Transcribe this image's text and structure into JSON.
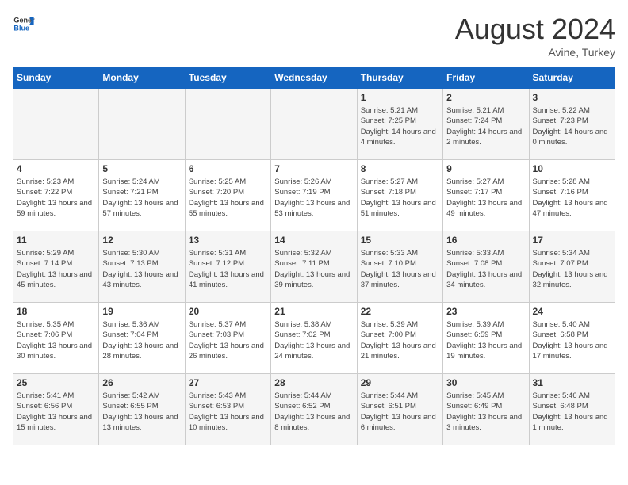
{
  "header": {
    "logo_general": "General",
    "logo_blue": "Blue",
    "title": "August 2024",
    "location": "Avine, Turkey"
  },
  "days_of_week": [
    "Sunday",
    "Monday",
    "Tuesday",
    "Wednesday",
    "Thursday",
    "Friday",
    "Saturday"
  ],
  "weeks": [
    [
      {
        "day": "",
        "sunrise": "",
        "sunset": "",
        "daylight": "",
        "empty": true
      },
      {
        "day": "",
        "sunrise": "",
        "sunset": "",
        "daylight": "",
        "empty": true
      },
      {
        "day": "",
        "sunrise": "",
        "sunset": "",
        "daylight": "",
        "empty": true
      },
      {
        "day": "",
        "sunrise": "",
        "sunset": "",
        "daylight": "",
        "empty": true
      },
      {
        "day": "1",
        "sunrise": "Sunrise: 5:21 AM",
        "sunset": "Sunset: 7:25 PM",
        "daylight": "Daylight: 14 hours and 4 minutes.",
        "empty": false
      },
      {
        "day": "2",
        "sunrise": "Sunrise: 5:21 AM",
        "sunset": "Sunset: 7:24 PM",
        "daylight": "Daylight: 14 hours and 2 minutes.",
        "empty": false
      },
      {
        "day": "3",
        "sunrise": "Sunrise: 5:22 AM",
        "sunset": "Sunset: 7:23 PM",
        "daylight": "Daylight: 14 hours and 0 minutes.",
        "empty": false
      }
    ],
    [
      {
        "day": "4",
        "sunrise": "Sunrise: 5:23 AM",
        "sunset": "Sunset: 7:22 PM",
        "daylight": "Daylight: 13 hours and 59 minutes.",
        "empty": false
      },
      {
        "day": "5",
        "sunrise": "Sunrise: 5:24 AM",
        "sunset": "Sunset: 7:21 PM",
        "daylight": "Daylight: 13 hours and 57 minutes.",
        "empty": false
      },
      {
        "day": "6",
        "sunrise": "Sunrise: 5:25 AM",
        "sunset": "Sunset: 7:20 PM",
        "daylight": "Daylight: 13 hours and 55 minutes.",
        "empty": false
      },
      {
        "day": "7",
        "sunrise": "Sunrise: 5:26 AM",
        "sunset": "Sunset: 7:19 PM",
        "daylight": "Daylight: 13 hours and 53 minutes.",
        "empty": false
      },
      {
        "day": "8",
        "sunrise": "Sunrise: 5:27 AM",
        "sunset": "Sunset: 7:18 PM",
        "daylight": "Daylight: 13 hours and 51 minutes.",
        "empty": false
      },
      {
        "day": "9",
        "sunrise": "Sunrise: 5:27 AM",
        "sunset": "Sunset: 7:17 PM",
        "daylight": "Daylight: 13 hours and 49 minutes.",
        "empty": false
      },
      {
        "day": "10",
        "sunrise": "Sunrise: 5:28 AM",
        "sunset": "Sunset: 7:16 PM",
        "daylight": "Daylight: 13 hours and 47 minutes.",
        "empty": false
      }
    ],
    [
      {
        "day": "11",
        "sunrise": "Sunrise: 5:29 AM",
        "sunset": "Sunset: 7:14 PM",
        "daylight": "Daylight: 13 hours and 45 minutes.",
        "empty": false
      },
      {
        "day": "12",
        "sunrise": "Sunrise: 5:30 AM",
        "sunset": "Sunset: 7:13 PM",
        "daylight": "Daylight: 13 hours and 43 minutes.",
        "empty": false
      },
      {
        "day": "13",
        "sunrise": "Sunrise: 5:31 AM",
        "sunset": "Sunset: 7:12 PM",
        "daylight": "Daylight: 13 hours and 41 minutes.",
        "empty": false
      },
      {
        "day": "14",
        "sunrise": "Sunrise: 5:32 AM",
        "sunset": "Sunset: 7:11 PM",
        "daylight": "Daylight: 13 hours and 39 minutes.",
        "empty": false
      },
      {
        "day": "15",
        "sunrise": "Sunrise: 5:33 AM",
        "sunset": "Sunset: 7:10 PM",
        "daylight": "Daylight: 13 hours and 37 minutes.",
        "empty": false
      },
      {
        "day": "16",
        "sunrise": "Sunrise: 5:33 AM",
        "sunset": "Sunset: 7:08 PM",
        "daylight": "Daylight: 13 hours and 34 minutes.",
        "empty": false
      },
      {
        "day": "17",
        "sunrise": "Sunrise: 5:34 AM",
        "sunset": "Sunset: 7:07 PM",
        "daylight": "Daylight: 13 hours and 32 minutes.",
        "empty": false
      }
    ],
    [
      {
        "day": "18",
        "sunrise": "Sunrise: 5:35 AM",
        "sunset": "Sunset: 7:06 PM",
        "daylight": "Daylight: 13 hours and 30 minutes.",
        "empty": false
      },
      {
        "day": "19",
        "sunrise": "Sunrise: 5:36 AM",
        "sunset": "Sunset: 7:04 PM",
        "daylight": "Daylight: 13 hours and 28 minutes.",
        "empty": false
      },
      {
        "day": "20",
        "sunrise": "Sunrise: 5:37 AM",
        "sunset": "Sunset: 7:03 PM",
        "daylight": "Daylight: 13 hours and 26 minutes.",
        "empty": false
      },
      {
        "day": "21",
        "sunrise": "Sunrise: 5:38 AM",
        "sunset": "Sunset: 7:02 PM",
        "daylight": "Daylight: 13 hours and 24 minutes.",
        "empty": false
      },
      {
        "day": "22",
        "sunrise": "Sunrise: 5:39 AM",
        "sunset": "Sunset: 7:00 PM",
        "daylight": "Daylight: 13 hours and 21 minutes.",
        "empty": false
      },
      {
        "day": "23",
        "sunrise": "Sunrise: 5:39 AM",
        "sunset": "Sunset: 6:59 PM",
        "daylight": "Daylight: 13 hours and 19 minutes.",
        "empty": false
      },
      {
        "day": "24",
        "sunrise": "Sunrise: 5:40 AM",
        "sunset": "Sunset: 6:58 PM",
        "daylight": "Daylight: 13 hours and 17 minutes.",
        "empty": false
      }
    ],
    [
      {
        "day": "25",
        "sunrise": "Sunrise: 5:41 AM",
        "sunset": "Sunset: 6:56 PM",
        "daylight": "Daylight: 13 hours and 15 minutes.",
        "empty": false
      },
      {
        "day": "26",
        "sunrise": "Sunrise: 5:42 AM",
        "sunset": "Sunset: 6:55 PM",
        "daylight": "Daylight: 13 hours and 13 minutes.",
        "empty": false
      },
      {
        "day": "27",
        "sunrise": "Sunrise: 5:43 AM",
        "sunset": "Sunset: 6:53 PM",
        "daylight": "Daylight: 13 hours and 10 minutes.",
        "empty": false
      },
      {
        "day": "28",
        "sunrise": "Sunrise: 5:44 AM",
        "sunset": "Sunset: 6:52 PM",
        "daylight": "Daylight: 13 hours and 8 minutes.",
        "empty": false
      },
      {
        "day": "29",
        "sunrise": "Sunrise: 5:44 AM",
        "sunset": "Sunset: 6:51 PM",
        "daylight": "Daylight: 13 hours and 6 minutes.",
        "empty": false
      },
      {
        "day": "30",
        "sunrise": "Sunrise: 5:45 AM",
        "sunset": "Sunset: 6:49 PM",
        "daylight": "Daylight: 13 hours and 3 minutes.",
        "empty": false
      },
      {
        "day": "31",
        "sunrise": "Sunrise: 5:46 AM",
        "sunset": "Sunset: 6:48 PM",
        "daylight": "Daylight: 13 hours and 1 minute.",
        "empty": false
      }
    ]
  ]
}
